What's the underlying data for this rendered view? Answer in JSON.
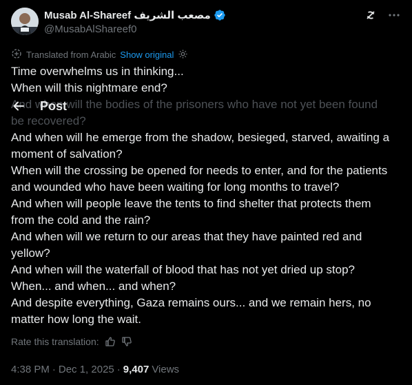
{
  "author": {
    "display_name": "Musab Al-Shareef مصعب الشريف",
    "handle": "@MusabAlShareef0"
  },
  "icons": [
    "avatar",
    "verified-badge-icon",
    "grok-icon",
    "more-icon",
    "translate-icon",
    "gear-icon",
    "back-arrow-icon",
    "thumbs-up-icon",
    "thumbs-down-icon"
  ],
  "colors": {
    "accent": "#1d9bf0",
    "text": "#e7e9ea",
    "muted": "#71767b",
    "background": "#000000"
  },
  "translation": {
    "label": "Translated from Arabic",
    "show_original": "Show original"
  },
  "header": {
    "title": "Post"
  },
  "post": {
    "lines": [
      "Time overwhelms us in thinking...",
      "When will this nightmare end?",
      "And when will the bodies of the prisoners who have not yet been found",
      "be recovered?",
      "And when will he emerge from the shadow, besieged, starved, awaiting a",
      "moment of salvation?",
      "When will the crossing be opened for needs to enter, and for the patients",
      "and wounded who have been waiting for long months to travel?",
      "And when will people leave the tents to find shelter that protects them",
      "from the cold and the rain?",
      "And when will we return to our areas that they have painted red and",
      "yellow?",
      "And when will the waterfall of blood that has not yet dried up stop?",
      "When... and when... and when?",
      "And despite everything, Gaza remains ours... and we remain hers, no",
      "matter how long the wait."
    ]
  },
  "rate": {
    "label": "Rate this translation:"
  },
  "meta": {
    "time": "4:38 PM",
    "date": "Dec 1, 2025",
    "views_count": "9,407",
    "views_label": "Views"
  }
}
